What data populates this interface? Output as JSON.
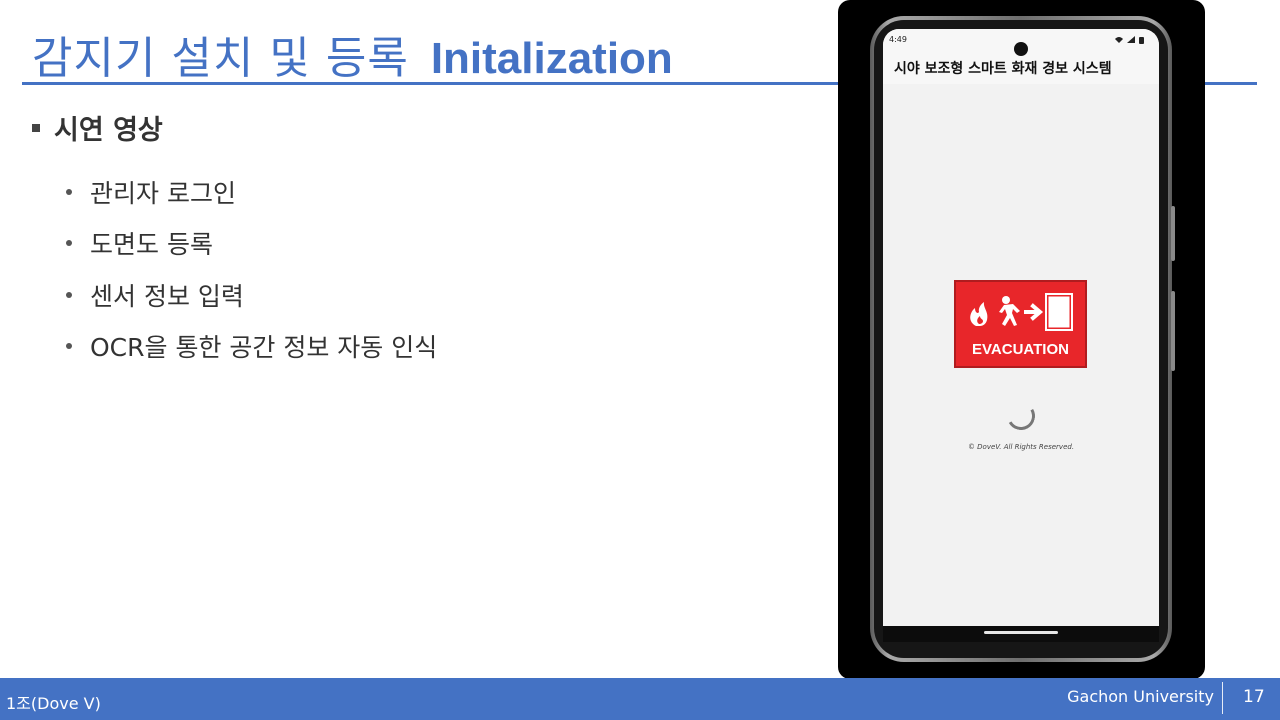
{
  "slide": {
    "title_korean": "감지기 설치 및 등록",
    "title_english": "Initalization",
    "main_bullet": "시연 영상",
    "sub_bullets": [
      "관리자 로그인",
      "도면도 등록",
      "센서 정보 입력",
      "OCR을 통한 공간 정보 자동 인식"
    ]
  },
  "phone": {
    "status_time": "4:49",
    "status_icons": "wifi-icon signal-icon battery-icon",
    "app_title": "시야 보조형 스마트 화재 경보 시스템",
    "sign_text": "EVACUATION",
    "copyright": "© DoveV. All Rights Reserved.",
    "loading": "loading-spinner"
  },
  "footer": {
    "team": "1조(Dove V)",
    "university": "Gachon  University",
    "page_number": "17"
  },
  "colors": {
    "accent": "#4472c4",
    "sign_red": "#e8262a",
    "text_dark": "#333333"
  }
}
